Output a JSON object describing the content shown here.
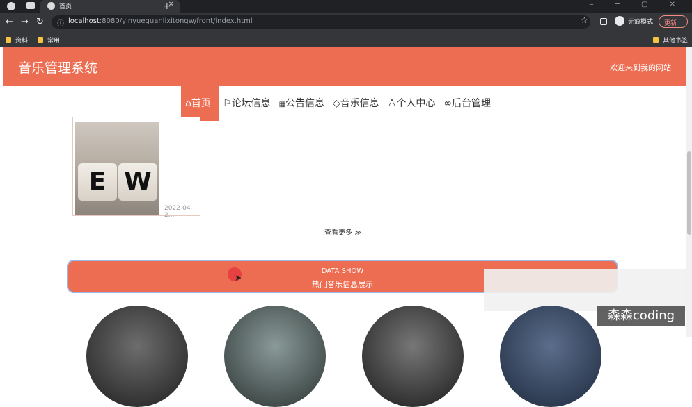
{
  "browser": {
    "tab_title": "首页",
    "url_host": "localhost",
    "url_rest": ":8080/yinyueguanlixitongw/front/index.html",
    "incognito_label": "无痕模式",
    "update_label": "更新",
    "bookmarks": [
      "资料",
      "常用"
    ],
    "other_bookmarks": "其他书签"
  },
  "header": {
    "logo": "音乐管理系统",
    "welcome": "欢迎来到我的网站"
  },
  "menu": [
    {
      "label": "首页",
      "icon": "home-icon",
      "glyph": "⌂",
      "active": true
    },
    {
      "label": "论坛信息",
      "icon": "flag-icon",
      "glyph": "⚐",
      "active": false
    },
    {
      "label": "公告信息",
      "icon": "grid-icon",
      "glyph": "▦",
      "active": false
    },
    {
      "label": "音乐信息",
      "icon": "tag-icon",
      "glyph": "◇",
      "active": false
    },
    {
      "label": "个人中心",
      "icon": "user-icon",
      "glyph": "♙",
      "active": false
    },
    {
      "label": "后台管理",
      "icon": "link-icon",
      "glyph": "∞",
      "active": false
    }
  ],
  "card": {
    "image_letters": [
      "E",
      "W"
    ],
    "date": "2022-04-2..."
  },
  "more": {
    "label": "查看更多",
    "glyph": "≫"
  },
  "banner": {
    "en": "DATA SHOW",
    "cn": "热门音乐信息展示"
  },
  "watermark": "森森coding",
  "colors": {
    "accent": "#ec6d51",
    "banner_border": "#9bb6e8"
  }
}
